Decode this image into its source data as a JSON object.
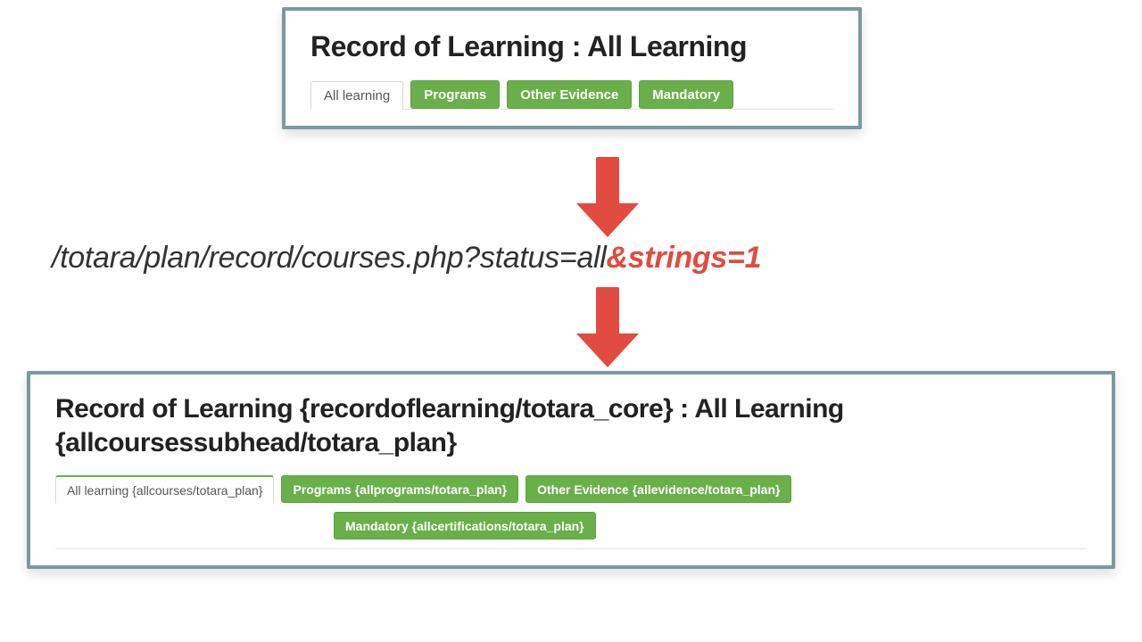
{
  "top_panel": {
    "heading": "Record of Learning : All Learning",
    "tabs": {
      "active": "All learning",
      "others": [
        "Programs",
        "Other Evidence",
        "Mandatory"
      ]
    }
  },
  "url": {
    "base": "/totara/plan/record/courses.php?status=all",
    "highlight": "&strings=1"
  },
  "bottom_panel": {
    "heading": "Record of Learning {recordoflearning/totara_core} : All Learning {allcoursessubhead/totara_plan}",
    "tabs": {
      "active": "All learning {allcourses/totara_plan}",
      "others_row1": [
        "Programs {allprograms/totara_plan}",
        "Other Evidence {allevidence/totara_plan}"
      ],
      "others_row2": [
        "Mandatory {allcertifications/totara_plan}"
      ]
    }
  }
}
